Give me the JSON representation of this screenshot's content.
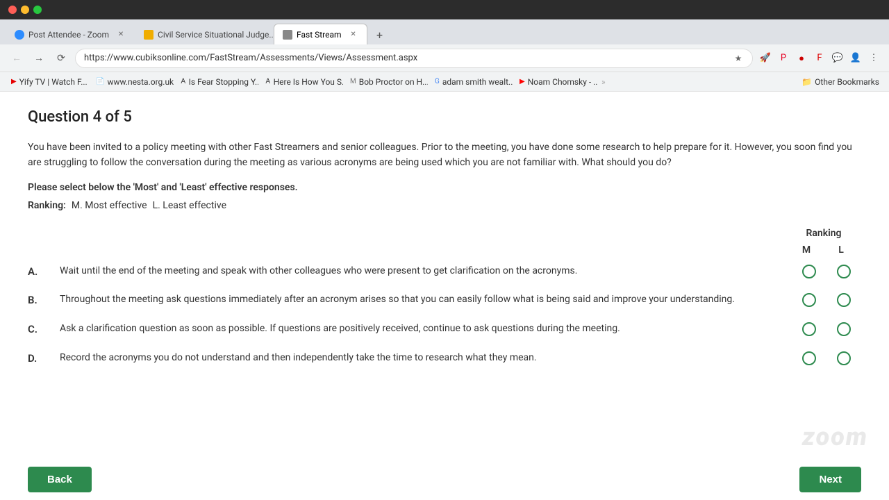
{
  "titlebar": {
    "traffic_red": "close",
    "traffic_yellow": "minimize",
    "traffic_green": "maximize"
  },
  "tabs": [
    {
      "id": "tab-zoom",
      "label": "Post Attendee - Zoom",
      "favicon_color": "#2d8cff",
      "active": false
    },
    {
      "id": "tab-civil",
      "label": "Civil Service Situational Judge...",
      "favicon_color": "#f0ad00",
      "active": false
    },
    {
      "id": "tab-fast",
      "label": "Fast Stream",
      "favicon_color": "#888888",
      "active": true
    }
  ],
  "addressbar": {
    "url": "https://www.cubiksonline.com/FastStream/Assessments/Views/Assessment.aspx"
  },
  "bookmarks": [
    {
      "label": "Yify TV | Watch F..."
    },
    {
      "label": "www.nesta.org.uk..."
    },
    {
      "label": "Is Fear Stopping Y..."
    },
    {
      "label": "Here Is How You S..."
    },
    {
      "label": "Bob Proctor on H..."
    },
    {
      "label": "adam smith wealt..."
    },
    {
      "label": "Noam Chomsky - ..."
    }
  ],
  "other_bookmarks_label": "Other Bookmarks",
  "question": {
    "title": "Question 4 of 5",
    "body": "You have been invited to a policy meeting with other Fast Streamers and senior colleagues. Prior to the meeting, you have done some research to help prepare for it. However, you soon find you are struggling to follow the conversation during the meeting as various acronyms are being used which you are not familiar with. What should you do?",
    "instruction": "Please select below the 'Most' and 'Least' effective responses.",
    "ranking_label": "Ranking:",
    "most_label": "M. Most effective",
    "least_label": "L. Least effective",
    "ranking_header": "Ranking",
    "col_m": "M",
    "col_l": "L"
  },
  "answers": [
    {
      "letter": "A.",
      "text": "Wait until the end of the meeting and speak with other colleagues who were present to get clarification on the acronyms."
    },
    {
      "letter": "B.",
      "text": "Throughout the meeting ask questions immediately after an acronym arises so that you can easily follow what is being said and improve your understanding."
    },
    {
      "letter": "C.",
      "text": "Ask a clarification question as soon as possible. If questions are positively received, continue to ask questions during the meeting."
    },
    {
      "letter": "D.",
      "text": "Record the acronyms you do not understand and then independently take the time to research what they mean."
    }
  ],
  "buttons": {
    "back": "Back",
    "next": "Next"
  },
  "zoom_watermark": "zoom"
}
